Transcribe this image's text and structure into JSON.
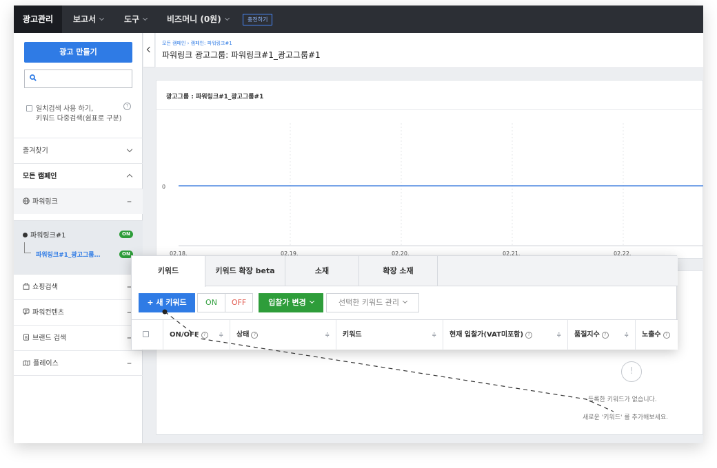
{
  "topbar": {
    "active_menu": "광고관리",
    "menus": [
      "보고서",
      "도구",
      "비즈머니 (0원)"
    ],
    "charge_button": "충전하기"
  },
  "sidebar": {
    "create_button": "광고 만들기",
    "exact_search_line1": "일치검색 사용 하기,",
    "exact_search_line2": "키워드 다중검색(쉼표로 구분)",
    "favorites": "즐겨찾기",
    "all_campaigns": "모든 캠페인",
    "campaign_types": [
      {
        "label": "파워링크",
        "icon": "globe-icon"
      },
      {
        "label": "쇼핑검색",
        "icon": "shopping-bag-icon"
      },
      {
        "label": "파워컨텐츠",
        "icon": "content-icon"
      },
      {
        "label": "브랜드 검색",
        "icon": "brand-icon"
      },
      {
        "label": "플레이스",
        "icon": "place-icon"
      }
    ],
    "campaign": {
      "label": "파워링크#1",
      "status": "ON"
    },
    "adgroup": {
      "label": "파워링크#1_광고그룹…",
      "status": "ON"
    }
  },
  "main": {
    "breadcrumb": "모든 캠페인 › 캠페인: 파워링크#1",
    "title": "파워링크 광고그룹: 파워링크#1_광고그룹#1",
    "chart_title": "광고그룹 : 파워링크#1_광고그룹#1",
    "empty_line1": "등록한 키워드가 없습니다.",
    "empty_line2": "새로운 '키워드' 를 추가해보세요.",
    "empty_icon": "!"
  },
  "chart_data": {
    "type": "line",
    "x": [
      "02.18.",
      "02.19.",
      "02.20.",
      "02.21.",
      "02.22."
    ],
    "series": [
      {
        "values": [
          0,
          0,
          0,
          0,
          0
        ]
      }
    ],
    "yticks": [
      "0"
    ],
    "color": "#4a86e0"
  },
  "panel": {
    "tabs": [
      "키워드",
      "키워드 확장 beta",
      "소재",
      "확장 소재"
    ],
    "new_keyword": "+ 새 키워드",
    "on": "ON",
    "off": "OFF",
    "bid_change": "입찰가 변경",
    "manage": "선택한 키워드 관리",
    "columns": [
      "ON/OFF",
      "상태",
      "키워드",
      "현재 입찰가(VAT미포함)",
      "품질지수",
      "노출수"
    ],
    "help_glyph": "?",
    "sort_glyph": "≑"
  },
  "colors": {
    "accent": "#2f7be5",
    "on": "#2e9d3a",
    "off": "#e0554a",
    "topbar": "#2c2f35"
  }
}
